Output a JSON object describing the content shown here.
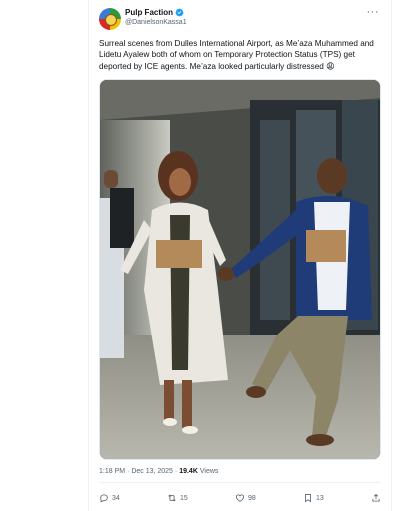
{
  "tweet": {
    "author": {
      "display_name": "Pulp Faction",
      "handle": "@DanielsonKassa1",
      "verified": true
    },
    "text": "Surreal scenes from Dulles International Airport, as Me’aza Muhammed and Lidetu Ayalew both of whom on Temporary Protection Status (TPS) get deported by ICE agents. Me’aza looked particularly distressed 😩",
    "meta": {
      "time": "1:18 PM",
      "date": "Dec 13, 2025",
      "separator": " · ",
      "views_count": "19.4K",
      "views_label": "Views"
    },
    "actions": {
      "replies": "34",
      "reposts": "15",
      "likes": "98",
      "bookmarks": "13"
    }
  },
  "colors": {
    "verified_blue": "#1d9bf0",
    "text_primary": "#0f1419",
    "text_secondary": "#536471"
  },
  "icons": [
    "verified-badge-icon",
    "more-options-icon",
    "reply-icon",
    "repost-icon",
    "like-icon",
    "bookmark-icon",
    "share-icon"
  ]
}
